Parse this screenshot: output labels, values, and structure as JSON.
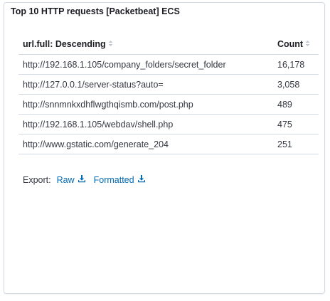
{
  "panel": {
    "title": "Top 10 HTTP requests [Packetbeat] ECS"
  },
  "table": {
    "columns": [
      {
        "label": "url.full: Descending",
        "sort_icon": "sort-icon"
      },
      {
        "label": "Count",
        "sort_icon": "sort-icon"
      }
    ],
    "rows": [
      {
        "url": "http://192.168.1.105/company_folders/secret_folder",
        "count": "16,178"
      },
      {
        "url": "http://127.0.0.1/server-status?auto=",
        "count": "3,058"
      },
      {
        "url": "http://snnmnkxdhflwgthqismb.com/post.php",
        "count": "489"
      },
      {
        "url": "http://192.168.1.105/webdav/shell.php",
        "count": "475"
      },
      {
        "url": "http://www.gstatic.com/generate_204",
        "count": "251"
      }
    ]
  },
  "export": {
    "label": "Export:",
    "raw_label": "Raw",
    "formatted_label": "Formatted",
    "icon": "download-icon"
  },
  "colors": {
    "link": "#006bb4",
    "border": "#d3dae6",
    "text": "#343741"
  }
}
